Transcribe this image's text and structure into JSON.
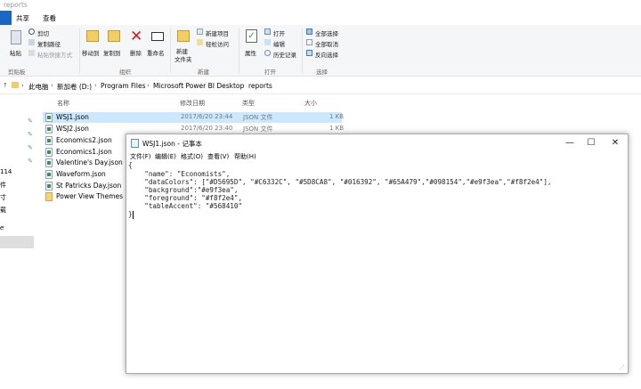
{
  "window": {
    "title": "reports"
  },
  "ribbon_tabs": [
    "共享",
    "查看"
  ],
  "ribbon": {
    "clipboard": {
      "paste": "粘贴",
      "cut": "剪切",
      "copy_path": "复制路径",
      "paste_shortcut": "粘贴快捷方式",
      "group": "剪贴板"
    },
    "organize": {
      "move_to": "移动到",
      "copy_to": "复制到",
      "delete": "删除",
      "rename": "重命名",
      "group": "组织"
    },
    "new": {
      "new_folder": "新建",
      "new_folder_2": "文件夹",
      "new_item": "新建项目",
      "easy_access": "轻松访问",
      "group": "新建"
    },
    "open": {
      "properties": "属性",
      "open": "打开",
      "edit": "编辑",
      "history": "历史记录",
      "group": "打开"
    },
    "select": {
      "select_all": "全部选择",
      "select_none": "全部取消",
      "invert": "反向选择",
      "group": "选择"
    }
  },
  "breadcrumb": [
    "此电脑",
    "新加卷 (D:)",
    "Program Files",
    "Microsoft Power BI Desktop",
    "reports"
  ],
  "columns": {
    "name": "名称",
    "date": "修改日期",
    "type": "类型",
    "size": "大小"
  },
  "files": [
    {
      "name": "WSJ1.json",
      "date": "2017/6/20 23:44",
      "type": "JSON 文件",
      "size": "1 KB"
    },
    {
      "name": "WSJ2.json",
      "date": "2017/6/20 23:40",
      "type": "JSON 文件",
      "size": "1 KB"
    },
    {
      "name": "Economics2.json"
    },
    {
      "name": "Economics1.json"
    },
    {
      "name": "Valentine's Day.json"
    },
    {
      "name": "Waveform.json"
    },
    {
      "name": "St Patricks Day.json"
    },
    {
      "name": "Power View Themes"
    }
  ],
  "nav_fragments": [
    "114",
    "件",
    "寸",
    "载",
    "e"
  ],
  "notepad": {
    "title": "WSJ1.json - 记事本",
    "menu": [
      "文件(F)",
      "编辑(E)",
      "格式(O)",
      "查看(V)",
      "帮助(H)"
    ],
    "lines": [
      "{",
      "    \"name\": \"Economists\",",
      "    \"dataColors\": [\"#D5695D\", \"#C6332C\", \"#5D8CA8\", \"#016392\", \"#65A479\",\"#098154\",\"#e9f3ea\",\"#f8f2e4\"],",
      "    \"background\":\"#e9f3ea\",",
      "    \"foreground\": \"#f8f2e4\",",
      "    \"tableAccent\": \"#568410\"",
      "}"
    ]
  },
  "colors": {
    "selection": "#cce8ff",
    "file_tab": "#1a66c4"
  }
}
